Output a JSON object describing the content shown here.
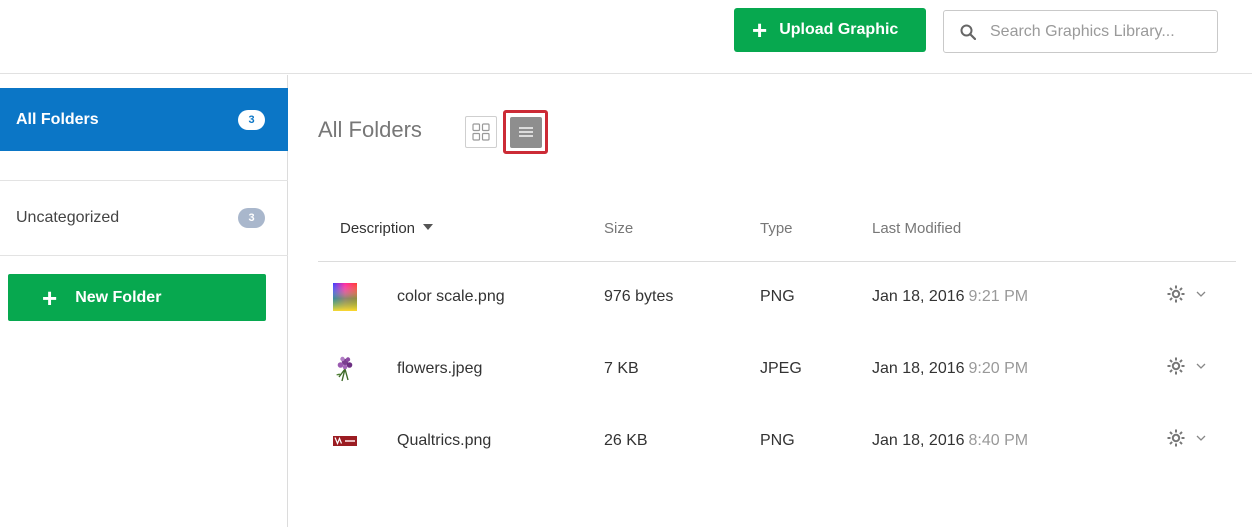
{
  "toolbar": {
    "upload_label": "Upload Graphic",
    "search_placeholder": "Search Graphics Library..."
  },
  "sidebar": {
    "folders": [
      {
        "label": "All Folders",
        "count": "3",
        "active": true
      },
      {
        "label": "Uncategorized",
        "count": "3",
        "active": false
      }
    ],
    "new_folder_label": "New Folder"
  },
  "main": {
    "title": "All Folders",
    "view_modes": [
      "grid-view-icon",
      "list-view-icon"
    ],
    "selected_view": "list"
  },
  "table": {
    "columns": [
      "Description",
      "Size",
      "Type",
      "Last Modified"
    ],
    "rows": [
      {
        "thumb": "color-scale-thumbnail",
        "name": "color scale.png",
        "size": "976 bytes",
        "type": "PNG",
        "date": "Jan 18, 2016",
        "time": "9:21 PM"
      },
      {
        "thumb": "flowers-thumbnail",
        "name": "flowers.jpeg",
        "size": "7 KB",
        "type": "JPEG",
        "date": "Jan 18, 2016",
        "time": "9:20 PM"
      },
      {
        "thumb": "qualtrics-logo-thumbnail",
        "name": "Qualtrics.png",
        "size": "26 KB",
        "type": "PNG",
        "date": "Jan 18, 2016",
        "time": "8:40 PM"
      }
    ]
  },
  "colors": {
    "accent_green": "#07a84f",
    "active_blue": "#0b76c6",
    "highlight_red": "#cc2b36"
  }
}
